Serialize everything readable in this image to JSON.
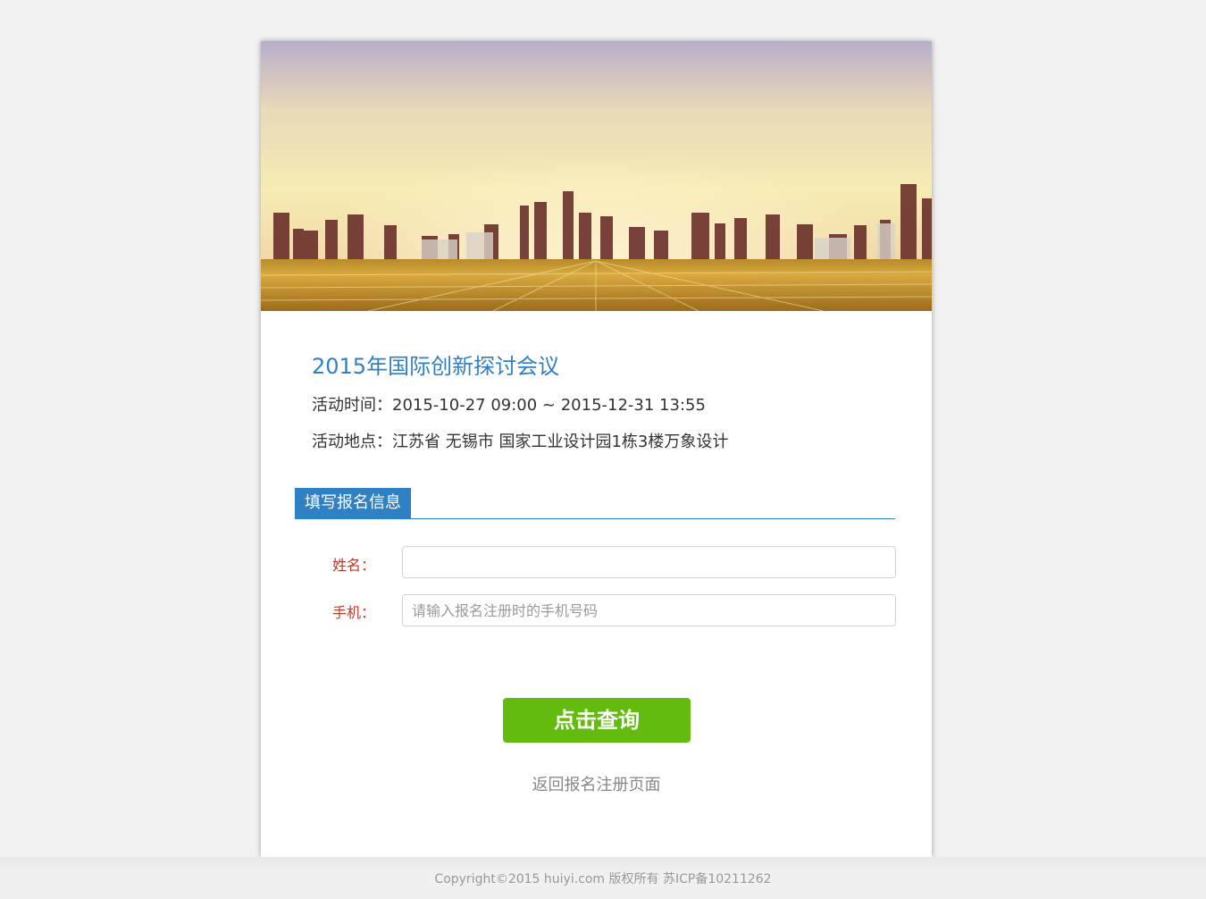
{
  "event": {
    "title": "2015年国际创新探讨会议",
    "time_line": "活动时间：2015-10-27 09:00 ~ 2015-12-31 13:55",
    "place_line": "活动地点：江苏省 无锡市 国家工业设计园1栋3楼万象设计"
  },
  "form": {
    "section_title": "填写报名信息",
    "name_label": "姓名：",
    "name_value": "",
    "phone_label": "手机：",
    "phone_placeholder": "请输入报名注册时的手机号码",
    "phone_value": "",
    "submit_label": "点击查询",
    "return_link": "返回报名注册页面"
  },
  "footer": {
    "copyright": "Copyright©2015 huiyi.com 版权所有 苏ICP备10211262"
  },
  "colors": {
    "accent_blue": "#2f80c5",
    "submit_green": "#62bb0d",
    "label_red": "#c0392b"
  },
  "icons": {
    "banner": "city-skyline-image"
  }
}
